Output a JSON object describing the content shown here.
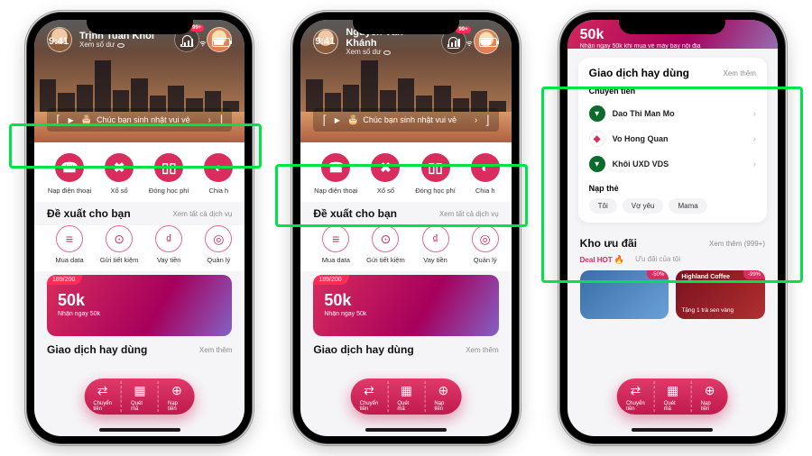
{
  "status_time": "9:41",
  "phone1": {
    "user_name": "Trịnh Tuấn Khôi",
    "balance_label": "Xem số dư",
    "badge": "99+",
    "birthday_text": "Chúc bạn sinh nhật vui vẻ",
    "quick": [
      {
        "label": "Nạp điện thoại"
      },
      {
        "label": "Xổ số"
      },
      {
        "label": "Đóng học phí"
      },
      {
        "label": "Chia h"
      }
    ],
    "suggest_title": "Đề xuất cho bạn",
    "suggest_more": "Xem tất cả dịch vụ",
    "suggest": [
      {
        "label": "Mua data"
      },
      {
        "label": "Gửi tiết kiệm"
      },
      {
        "label": "Vay tiền"
      },
      {
        "label": "Quản lý"
      }
    ],
    "promo_tag": "189/200",
    "promo_title": "50k",
    "promo_sub": "Nhận ngay 50k",
    "freq_title": "Giao dịch hay dùng",
    "freq_more": "Xem thêm",
    "fab": [
      {
        "label": "Chuyển tiền"
      },
      {
        "label": "Quét mã"
      },
      {
        "label": "Nạp tiền"
      }
    ]
  },
  "phone2": {
    "user_name": "Nguyễn Văn  Khánh",
    "balance_label": "Xem số dư",
    "badge": "99+",
    "birthday_text": "Chúc bạn sinh nhật vui vẻ",
    "quick": [
      {
        "label": "Nạp điện thoại"
      },
      {
        "label": "Xổ số"
      },
      {
        "label": "Đóng học phí"
      },
      {
        "label": "Chia h"
      }
    ],
    "suggest_title": "Đề xuất cho bạn",
    "suggest_more": "Xem tất cả dịch vụ",
    "suggest": [
      {
        "label": "Mua data"
      },
      {
        "label": "Gửi tiết kiệm"
      },
      {
        "label": "Vay tiền"
      },
      {
        "label": "Quản lý"
      }
    ],
    "promo_tag": "189/200",
    "promo_title": "50k",
    "promo_sub": "Nhận ngay 50k",
    "freq_title": "Giao dịch hay dùng",
    "freq_more": "Xem thêm",
    "fab": [
      {
        "label": "Chuyển tiền"
      },
      {
        "label": "Quét mã"
      },
      {
        "label": "Nạp tiền"
      }
    ]
  },
  "phone3": {
    "top_title": "50k",
    "top_sub": "Nhận ngay 50k khi mua vé máy bay nội địa",
    "freq_title": "Giao dịch hay dùng",
    "freq_more": "Xem thêm",
    "sub_transfer": "Chuyển tiền",
    "contacts": [
      {
        "name": "Dao Thi Man Mo",
        "style": "green"
      },
      {
        "name": "Vo Hong Quan",
        "style": "red"
      },
      {
        "name": "Khôi UXD VDS",
        "style": "green"
      }
    ],
    "sub_topup": "Nạp thẻ",
    "chips": [
      "Tôi",
      "Vợ yêu",
      "Mama"
    ],
    "kho_title": "Kho ưu đãi",
    "kho_more": "Xem thêm (999+)",
    "tab_hot": "Deal HOT",
    "tab_mine": "Ưu đãi của tôi",
    "offer1_brand": "",
    "offer1_badge": "-50%",
    "offer2_brand": "Highland Coffee",
    "offer2_badge": "-99%",
    "offer2_sub": "Tặng 1 trà sen vàng",
    "fab": [
      {
        "label": "Chuyển tiền"
      },
      {
        "label": "Quét mã"
      },
      {
        "label": "Nạp tiền"
      }
    ]
  }
}
